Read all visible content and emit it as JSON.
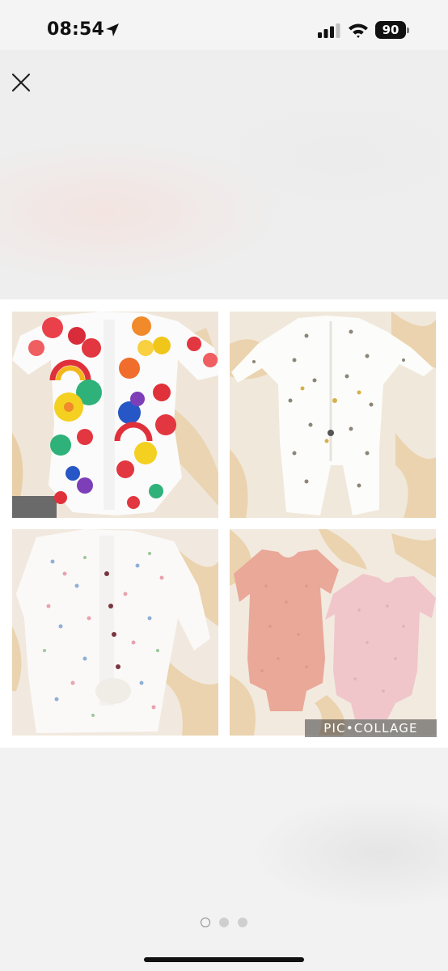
{
  "status_bar": {
    "time": "08:54",
    "battery_level": "90",
    "icons": [
      "location-arrow-icon",
      "cellular-signal-icon",
      "wifi-icon",
      "battery-icon"
    ]
  },
  "viewer": {
    "close_icon": "close-icon",
    "photo_count": 3,
    "current_photo_index": 1
  },
  "collage": {
    "watermark": "PIC•COLLAGE",
    "photos": [
      {
        "subject": "white sleepsuit with colourful fruit and flower print"
      },
      {
        "subject": "white sleepsuit with small bee print"
      },
      {
        "subject": "white sleepsuit with tiny floral print"
      },
      {
        "subject": "two pink short-sleeve bodysuits"
      }
    ]
  },
  "colors": {
    "background": "#f4f4f4",
    "collage_background": "#ffffff",
    "blanket_cream": "#f2e9de",
    "blanket_leaf": "#ead4b4",
    "bodysuit_peach": "#e9a898",
    "bodysuit_pink": "#f0c6cb"
  }
}
